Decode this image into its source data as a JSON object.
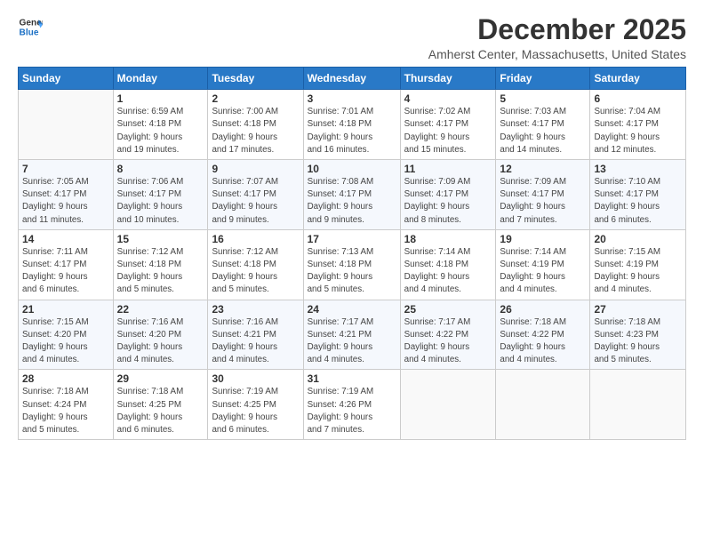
{
  "logo": {
    "text1": "General",
    "text2": "Blue"
  },
  "title": "December 2025",
  "subtitle": "Amherst Center, Massachusetts, United States",
  "days_header": [
    "Sunday",
    "Monday",
    "Tuesday",
    "Wednesday",
    "Thursday",
    "Friday",
    "Saturday"
  ],
  "weeks": [
    [
      {
        "day": "",
        "info": ""
      },
      {
        "day": "1",
        "info": "Sunrise: 6:59 AM\nSunset: 4:18 PM\nDaylight: 9 hours\nand 19 minutes."
      },
      {
        "day": "2",
        "info": "Sunrise: 7:00 AM\nSunset: 4:18 PM\nDaylight: 9 hours\nand 17 minutes."
      },
      {
        "day": "3",
        "info": "Sunrise: 7:01 AM\nSunset: 4:18 PM\nDaylight: 9 hours\nand 16 minutes."
      },
      {
        "day": "4",
        "info": "Sunrise: 7:02 AM\nSunset: 4:17 PM\nDaylight: 9 hours\nand 15 minutes."
      },
      {
        "day": "5",
        "info": "Sunrise: 7:03 AM\nSunset: 4:17 PM\nDaylight: 9 hours\nand 14 minutes."
      },
      {
        "day": "6",
        "info": "Sunrise: 7:04 AM\nSunset: 4:17 PM\nDaylight: 9 hours\nand 12 minutes."
      }
    ],
    [
      {
        "day": "7",
        "info": "Sunrise: 7:05 AM\nSunset: 4:17 PM\nDaylight: 9 hours\nand 11 minutes."
      },
      {
        "day": "8",
        "info": "Sunrise: 7:06 AM\nSunset: 4:17 PM\nDaylight: 9 hours\nand 10 minutes."
      },
      {
        "day": "9",
        "info": "Sunrise: 7:07 AM\nSunset: 4:17 PM\nDaylight: 9 hours\nand 9 minutes."
      },
      {
        "day": "10",
        "info": "Sunrise: 7:08 AM\nSunset: 4:17 PM\nDaylight: 9 hours\nand 9 minutes."
      },
      {
        "day": "11",
        "info": "Sunrise: 7:09 AM\nSunset: 4:17 PM\nDaylight: 9 hours\nand 8 minutes."
      },
      {
        "day": "12",
        "info": "Sunrise: 7:09 AM\nSunset: 4:17 PM\nDaylight: 9 hours\nand 7 minutes."
      },
      {
        "day": "13",
        "info": "Sunrise: 7:10 AM\nSunset: 4:17 PM\nDaylight: 9 hours\nand 6 minutes."
      }
    ],
    [
      {
        "day": "14",
        "info": "Sunrise: 7:11 AM\nSunset: 4:17 PM\nDaylight: 9 hours\nand 6 minutes."
      },
      {
        "day": "15",
        "info": "Sunrise: 7:12 AM\nSunset: 4:18 PM\nDaylight: 9 hours\nand 5 minutes."
      },
      {
        "day": "16",
        "info": "Sunrise: 7:12 AM\nSunset: 4:18 PM\nDaylight: 9 hours\nand 5 minutes."
      },
      {
        "day": "17",
        "info": "Sunrise: 7:13 AM\nSunset: 4:18 PM\nDaylight: 9 hours\nand 5 minutes."
      },
      {
        "day": "18",
        "info": "Sunrise: 7:14 AM\nSunset: 4:18 PM\nDaylight: 9 hours\nand 4 minutes."
      },
      {
        "day": "19",
        "info": "Sunrise: 7:14 AM\nSunset: 4:19 PM\nDaylight: 9 hours\nand 4 minutes."
      },
      {
        "day": "20",
        "info": "Sunrise: 7:15 AM\nSunset: 4:19 PM\nDaylight: 9 hours\nand 4 minutes."
      }
    ],
    [
      {
        "day": "21",
        "info": "Sunrise: 7:15 AM\nSunset: 4:20 PM\nDaylight: 9 hours\nand 4 minutes."
      },
      {
        "day": "22",
        "info": "Sunrise: 7:16 AM\nSunset: 4:20 PM\nDaylight: 9 hours\nand 4 minutes."
      },
      {
        "day": "23",
        "info": "Sunrise: 7:16 AM\nSunset: 4:21 PM\nDaylight: 9 hours\nand 4 minutes."
      },
      {
        "day": "24",
        "info": "Sunrise: 7:17 AM\nSunset: 4:21 PM\nDaylight: 9 hours\nand 4 minutes."
      },
      {
        "day": "25",
        "info": "Sunrise: 7:17 AM\nSunset: 4:22 PM\nDaylight: 9 hours\nand 4 minutes."
      },
      {
        "day": "26",
        "info": "Sunrise: 7:18 AM\nSunset: 4:22 PM\nDaylight: 9 hours\nand 4 minutes."
      },
      {
        "day": "27",
        "info": "Sunrise: 7:18 AM\nSunset: 4:23 PM\nDaylight: 9 hours\nand 5 minutes."
      }
    ],
    [
      {
        "day": "28",
        "info": "Sunrise: 7:18 AM\nSunset: 4:24 PM\nDaylight: 9 hours\nand 5 minutes."
      },
      {
        "day": "29",
        "info": "Sunrise: 7:18 AM\nSunset: 4:25 PM\nDaylight: 9 hours\nand 6 minutes."
      },
      {
        "day": "30",
        "info": "Sunrise: 7:19 AM\nSunset: 4:25 PM\nDaylight: 9 hours\nand 6 minutes."
      },
      {
        "day": "31",
        "info": "Sunrise: 7:19 AM\nSunset: 4:26 PM\nDaylight: 9 hours\nand 7 minutes."
      },
      {
        "day": "",
        "info": ""
      },
      {
        "day": "",
        "info": ""
      },
      {
        "day": "",
        "info": ""
      }
    ]
  ]
}
